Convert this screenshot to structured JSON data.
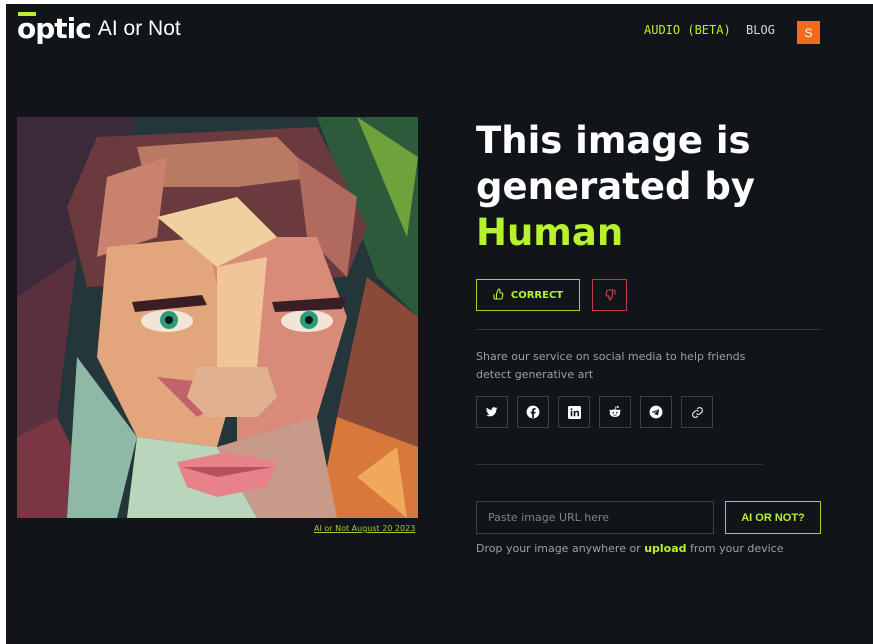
{
  "header": {
    "logo_mark": "optic",
    "logo_text": "AI or Not",
    "nav_audio": "AUDIO (BETA)",
    "nav_blog": "BLOG",
    "avatar_initial": "S"
  },
  "image": {
    "caption": "AI or Not August 20 2023"
  },
  "result": {
    "line1": "This image is",
    "line2": "generated by",
    "verdict": "Human",
    "correct_label": "CORRECT"
  },
  "share": {
    "text": "Share our service on social media to help friends detect generative art",
    "icons": [
      "twitter-icon",
      "facebook-icon",
      "linkedin-icon",
      "reddit-icon",
      "telegram-icon",
      "link-icon"
    ]
  },
  "upload": {
    "placeholder": "Paste image URL here",
    "button": "AI OR NOT?",
    "drop_before": "Drop your image anywhere or ",
    "drop_link": "upload",
    "drop_after": " from your device"
  },
  "colors": {
    "background": "#111418",
    "accent": "#b8f22f",
    "danger": "#c03a46",
    "avatar": "#f26b1d"
  }
}
